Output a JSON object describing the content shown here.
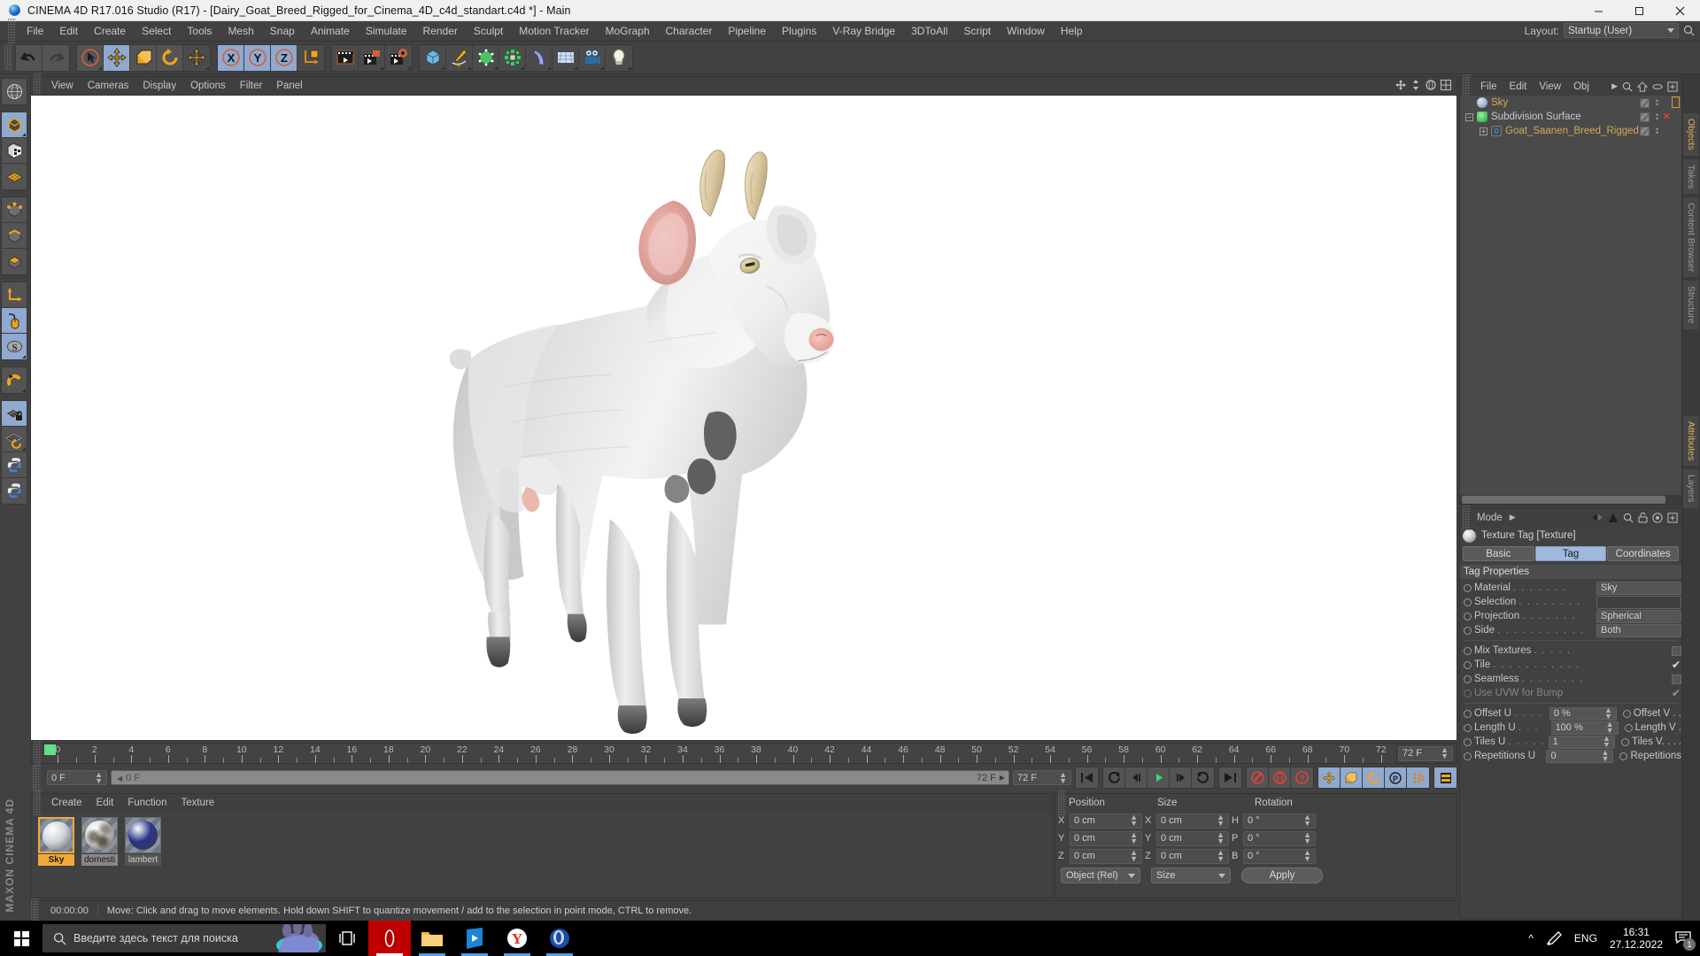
{
  "window": {
    "title": "CINEMA 4D R17.016 Studio (R17) - [Dairy_Goat_Breed_Rigged_for_Cinema_4D_c4d_standart.c4d *] - Main",
    "minimize": "—",
    "maximize": "□",
    "close": "✕"
  },
  "menubar": {
    "items": [
      "File",
      "Edit",
      "Create",
      "Select",
      "Tools",
      "Mesh",
      "Snap",
      "Animate",
      "Simulate",
      "Render",
      "Sculpt",
      "Motion Tracker",
      "MoGraph",
      "Character",
      "Pipeline",
      "Plugins",
      "V-Ray Bridge",
      "3DToAll",
      "Script",
      "Window",
      "Help"
    ],
    "layout_label": "Layout:",
    "layout_value": "Startup (User)"
  },
  "viewport": {
    "menu": [
      "View",
      "Cameras",
      "Display",
      "Options",
      "Filter",
      "Panel"
    ]
  },
  "timeline": {
    "start_frame": "0 F",
    "current_frame_field": "0 F",
    "end_field": "72 F",
    "end_frame": "72 F",
    "ticks": [
      0,
      2,
      4,
      6,
      8,
      10,
      12,
      14,
      16,
      18,
      20,
      22,
      24,
      26,
      28,
      30,
      32,
      34,
      36,
      38,
      40,
      42,
      44,
      46,
      48,
      50,
      52,
      54,
      56,
      58,
      60,
      62,
      64,
      66,
      68,
      70,
      72
    ]
  },
  "materials": {
    "menu": [
      "Create",
      "Edit",
      "Function",
      "Texture"
    ],
    "items": [
      {
        "name": "Sky",
        "selected": true,
        "color": "#cfd3d8"
      },
      {
        "name": "domesti",
        "selected": false,
        "highlight": true,
        "color": "#d8d4cc"
      },
      {
        "name": "lambert",
        "selected": false,
        "highlight": false,
        "color": "#2b3588"
      }
    ]
  },
  "coordinates": {
    "headers": [
      "Position",
      "Size",
      "Rotation"
    ],
    "rows": [
      {
        "axis1": "X",
        "v1": "0 cm",
        "axis2": "X",
        "v2": "0 cm",
        "axis3": "H",
        "v3": "0 °"
      },
      {
        "axis1": "Y",
        "v1": "0 cm",
        "axis2": "Y",
        "v2": "0 cm",
        "axis3": "P",
        "v3": "0 °"
      },
      {
        "axis1": "Z",
        "v1": "0 cm",
        "axis2": "Z",
        "v2": "0 cm",
        "axis3": "B",
        "v3": "0 °"
      }
    ],
    "mode_select": "Object (Rel)",
    "size_select": "Size",
    "apply_button": "Apply"
  },
  "statusbar": {
    "time": "00:00:00",
    "message": "Move: Click and drag to move elements. Hold down SHIFT to quantize movement / add to the selection in point mode, CTRL to remove."
  },
  "object_manager": {
    "menu": [
      "File",
      "Edit",
      "View",
      "Obj"
    ],
    "objects": [
      {
        "label": "Sky",
        "indent": 0,
        "color": "#d3a857",
        "has_expand": false,
        "has_x": false
      },
      {
        "label": "Subdivision Surface",
        "indent": 0,
        "color": "#cacaca",
        "has_expand": true,
        "has_x": true
      },
      {
        "label": "Goat_Saanen_Breed_Rigged",
        "indent": 1,
        "color": "#d3a857",
        "has_expand": true,
        "has_x": false
      }
    ]
  },
  "attributes": {
    "mode_label": "Mode",
    "title": "Texture Tag [Texture]",
    "tabs": [
      {
        "label": "Basic",
        "active": false
      },
      {
        "label": "Tag",
        "active": true
      },
      {
        "label": "Coordinates",
        "active": false
      }
    ],
    "group_title": "Tag Properties",
    "props": [
      {
        "label": "Material",
        "dots": ". . . . . . .",
        "value": "Sky",
        "type": "field"
      },
      {
        "label": "Selection",
        "dots": ". . . . . . . .",
        "value": "",
        "type": "field-dark"
      },
      {
        "label": "Projection",
        "dots": ". . . . . . .",
        "value": "Spherical",
        "type": "field"
      },
      {
        "label": "Side",
        "dots": ". . . . . . . . . . .",
        "value": "Both",
        "type": "field"
      }
    ],
    "checks": [
      {
        "label": "Mix Textures",
        "dots": ". . . . .",
        "checked": false,
        "disabled": false
      },
      {
        "label": "Tile",
        "dots": ". . . . . . . . . . .",
        "checked": true,
        "disabled": false
      },
      {
        "label": "Seamless",
        "dots": ". . . . . . . .",
        "checked": false,
        "disabled": false
      },
      {
        "label": "Use UVW for Bump",
        "dots": "",
        "checked": true,
        "disabled": true
      }
    ],
    "uv_rows": [
      {
        "label": "Offset U",
        "dots": ". . . .",
        "value": "0 %",
        "right": "Offset V . ."
      },
      {
        "label": "Length U",
        "dots": ". . .",
        "value": "100 %",
        "right": "Length V ."
      },
      {
        "label": "Tiles U",
        "dots": ". . . . .",
        "value": "1",
        "right": "Tiles V. . . ."
      },
      {
        "label": "Repetitions U",
        "dots": "",
        "value": "0",
        "right": "Repetitions"
      }
    ]
  },
  "side_tabs": {
    "right_top": [
      "Objects",
      "Takes",
      "Content Browser",
      "Structure"
    ],
    "right_bottom": [
      "Attributes",
      "Layers"
    ]
  },
  "taskbar": {
    "search_placeholder": "Введите здесь текст для поиска",
    "language": "ENG",
    "time": "16:31",
    "date": "27.12.2022",
    "notification_count": "1"
  }
}
